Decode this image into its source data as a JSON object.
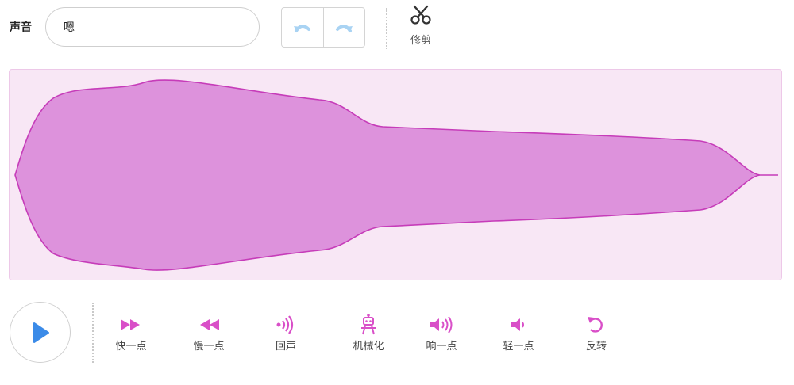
{
  "header": {
    "sound_label": "声音",
    "name_value": "嗯",
    "undo_icon": "undo-icon",
    "redo_icon": "redo-icon",
    "cut": {
      "label": "修剪",
      "icon": "scissors-icon"
    }
  },
  "playback": {
    "play_icon": "play-icon",
    "play_color": "#3b8be8"
  },
  "effects": [
    {
      "label": "快一点",
      "icon": "fast-forward-icon"
    },
    {
      "label": "慢一点",
      "icon": "rewind-icon"
    },
    {
      "label": "回声",
      "icon": "echo-icon"
    },
    {
      "label": "机械化",
      "icon": "robot-icon"
    },
    {
      "label": "响一点",
      "icon": "louder-icon"
    },
    {
      "label": "轻一点",
      "icon": "softer-icon"
    },
    {
      "label": "反转",
      "icon": "reverse-icon"
    }
  ],
  "colors": {
    "accent": "#d94fc8",
    "wave_fill": "#dd92dc",
    "wave_stroke": "#c63cb9",
    "panel_bg": "#f8e7f5",
    "icon_light_blue": "#a9d3f3"
  }
}
